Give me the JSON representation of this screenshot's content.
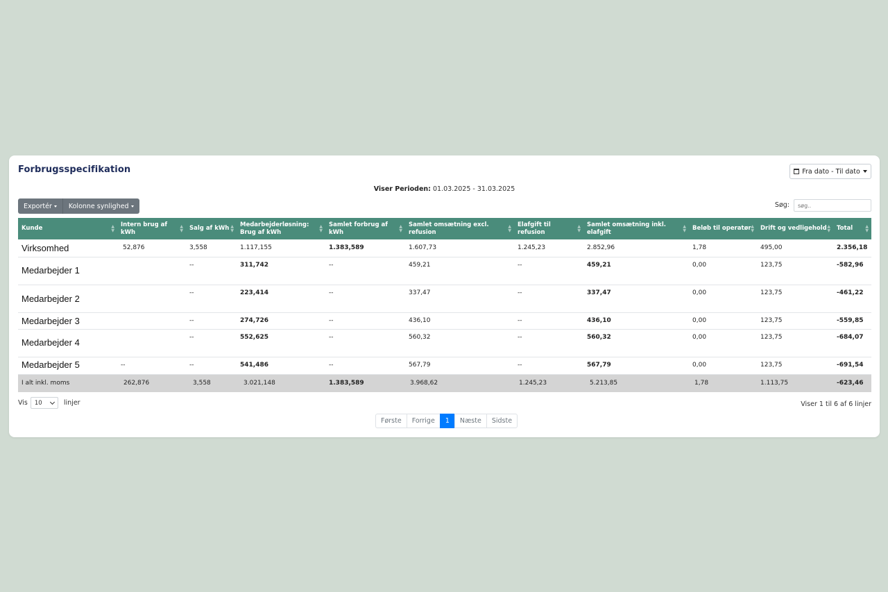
{
  "card": {
    "title": "Forbrugsspecifikation",
    "date_button": "Fra dato - Til dato",
    "period_label": "Viser Perioden:",
    "period_value": "01.03.2025 - 31.03.2025"
  },
  "toolbar": {
    "export_label": "Exportér",
    "columns_label": "Kolonne synlighed",
    "search_label": "Søg:",
    "search_placeholder": "søg.."
  },
  "table": {
    "headers": [
      "Kunde",
      "Intern brug af kWh",
      "Salg af kWh",
      "Medarbejderløsning: Brug af kWh",
      "Samlet forbrug af kWh",
      "Samlet omsætning excl. refusion",
      "Elafgift til refusion",
      "Samlet omsætning inkl. elafgift",
      "Beløb til operatør",
      "Drift og vedligehold",
      "Total"
    ],
    "rows": [
      [
        "Virksomhed",
        "52,876",
        "3,558",
        "1.117,155",
        "1.383,589",
        "1.607,73",
        "1.245,23",
        "2.852,96",
        "1,78",
        "495,00",
        "2.356,18"
      ],
      [
        "Medarbejder 1",
        "",
        "--",
        "311,742",
        "--",
        "459,21",
        "--",
        "459,21",
        "0,00",
        "123,75",
        "-582,96"
      ],
      [
        "Medarbejder 2",
        "",
        "--",
        "223,414",
        "--",
        "337,47",
        "--",
        "337,47",
        "0,00",
        "123,75",
        "-461,22"
      ],
      [
        "Medarbejder 3",
        "",
        "--",
        "274,726",
        "--",
        "436,10",
        "--",
        "436,10",
        "0,00",
        "123,75",
        "-559,85"
      ],
      [
        "Medarbejder 4",
        "",
        "--",
        "552,625",
        "--",
        "560,32",
        "--",
        "560,32",
        "0,00",
        "123,75",
        "-684,07"
      ],
      [
        "Medarbejder 5",
        "--",
        "--",
        "541,486",
        "--",
        "567,79",
        "--",
        "567,79",
        "0,00",
        "123,75",
        "-691,54"
      ]
    ],
    "totals": [
      "I alt inkl. moms",
      "262,876",
      "3,558",
      "3.021,148",
      "1.383,589",
      "3.968,62",
      "1.245,23",
      "5.213,85",
      "1,78",
      "1.113,75",
      "-623,46"
    ]
  },
  "footer": {
    "show_label": "Vis",
    "page_length": "10",
    "lines_label": "linjer",
    "info": "Viser 1 til 6 af 6 linjer",
    "pager": [
      "Første",
      "Forrige",
      "1",
      "Næste",
      "Sidste"
    ],
    "active_page": "1"
  },
  "colors": {
    "header_bg": "#4a8c7b",
    "title": "#1d2b5a",
    "active_page": "#007bff",
    "background": "#d0dbd2"
  }
}
